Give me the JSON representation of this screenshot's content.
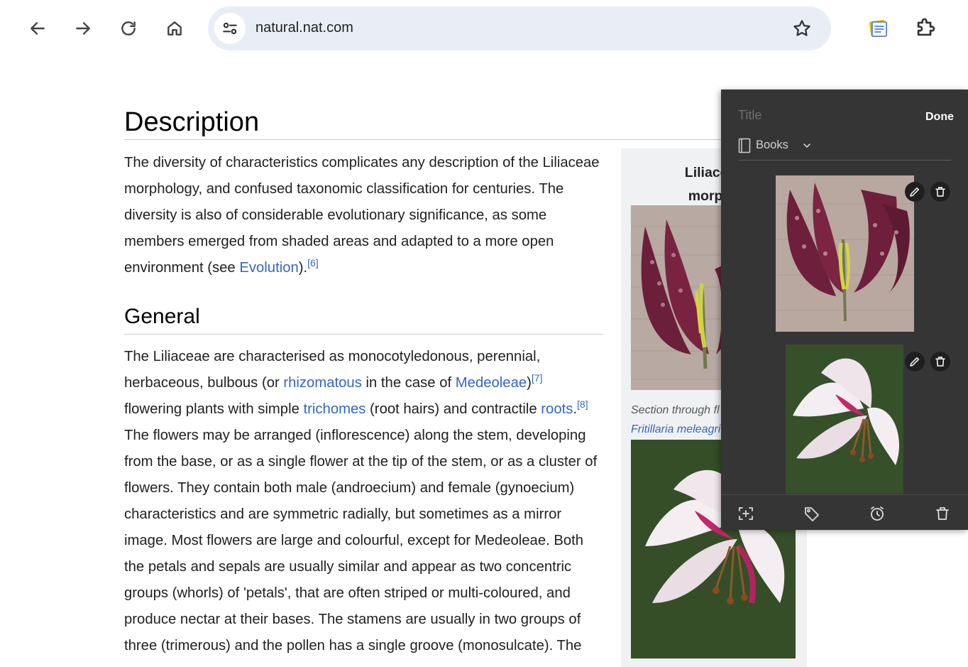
{
  "browser": {
    "url": "natural.nat.com",
    "icons": [
      "back-arrow-icon",
      "forward-arrow-icon",
      "reload-icon",
      "home-icon",
      "site-settings-icon",
      "bookmark-star-icon",
      "notes-extension-icon",
      "extensions-puzzle-icon"
    ]
  },
  "article": {
    "description_heading": "Description",
    "description_p": [
      {
        "t": "The diversity of characteristics complicates any description of the Liliaceae morphology, and confused taxonomic classification for centuries. The diversity is also of considerable evolutionary significance, as some members emerged from shaded areas and adapted to a more open environment (see "
      },
      {
        "t": "Evolution",
        "link": true
      },
      {
        "t": ")."
      },
      {
        "t": "[6]",
        "ref": true
      }
    ],
    "general_heading": "General",
    "general_p": [
      {
        "t": "The Liliaceae are characterised as monocotyledonous, perennial, herbaceous, bulbous (or "
      },
      {
        "t": "rhizomatous",
        "link": true
      },
      {
        "t": " in the case of "
      },
      {
        "t": "Medeoleae",
        "link": true
      },
      {
        "t": ")"
      },
      {
        "t": "[7]",
        "ref": true
      },
      {
        "t": " flowering plants with simple "
      },
      {
        "t": "trichomes",
        "link": true
      },
      {
        "t": " (root hairs) and contractile "
      },
      {
        "t": "roots",
        "link": true
      },
      {
        "t": "."
      },
      {
        "t": "[8]",
        "ref": true
      },
      {
        "t": " The flowers may be arranged (inflorescence) along the stem, developing from the base, or as a single flower at the tip of the stem, or as a cluster of flowers. They contain both male (androecium) and female (gynoecium) characteristics and are symmetric radially, but sometimes as a mirror image. Most flowers are large and colourful, except for Medeoleae. Both the petals and sepals are usually similar and appear as two concentric groups (whorls) of 'petals', that are often striped or multi-coloured, and produce nectar at their bases. The stamens are usually in two groups of three (trimerous) and the pollen has a single groove (monosulcate). The"
      }
    ]
  },
  "infobox": {
    "title_line1": "Liliaceae",
    "title_line2": "morpho",
    "caption_line1": "Section through fl",
    "caption_line2": "Fritillaria meleagri"
  },
  "notes_panel": {
    "title_placeholder": "Title",
    "done_label": "Done",
    "notebook": "Books",
    "clips": [
      "fritillaria-section-clip",
      "pink-lily-clip"
    ],
    "footer_icons": [
      "capture-icon",
      "tag-icon",
      "reminder-alarm-icon",
      "delete-trash-icon"
    ]
  },
  "colors": {
    "link": "#3366cc",
    "panel_bg": "#353535",
    "omnibox_bg": "#e9eef6",
    "infobox_bg": "#f0f1f2"
  }
}
